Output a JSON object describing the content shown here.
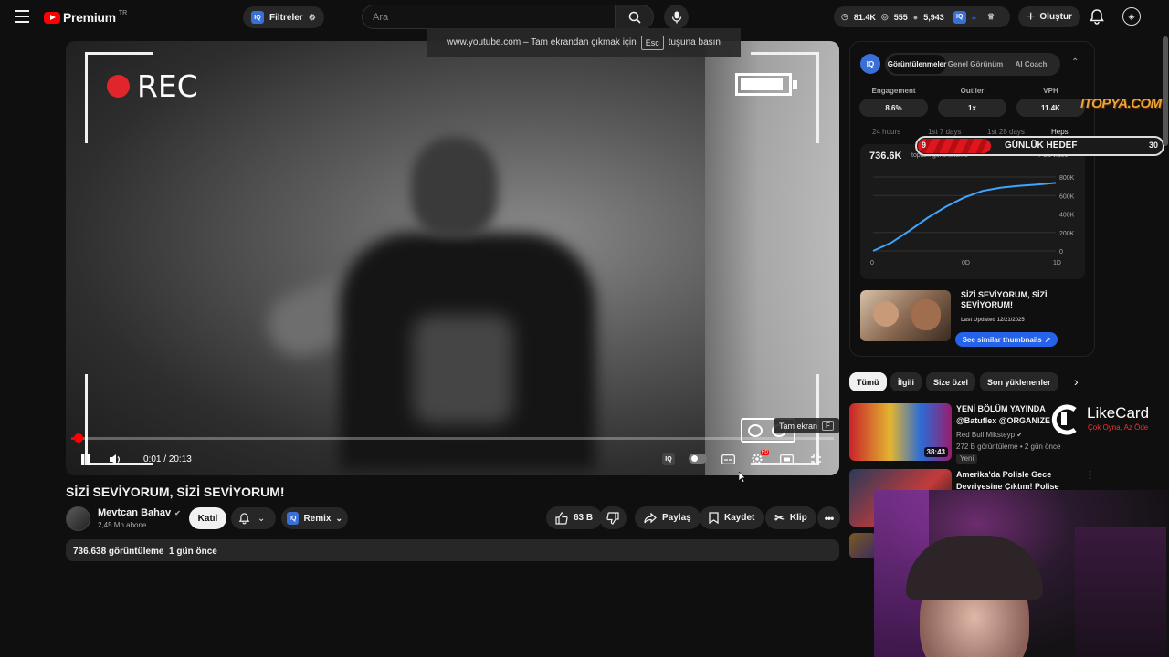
{
  "header": {
    "logo_text": "Premium",
    "logo_sup": "TR",
    "filters_label": "Filtreler",
    "search_placeholder": "Ara",
    "stats": {
      "a": "81.4K",
      "b": "555",
      "c": "5,943"
    },
    "create_label": "Oluştur"
  },
  "fullscreen_notice": {
    "text_before": "www.youtube.com – Tam ekrandan çıkmak için",
    "key": "Esc",
    "text_after": "tuşuna basın"
  },
  "player": {
    "overlay_rec": "REC",
    "time_current": "0:01",
    "time_total": "20:13",
    "progress_fraction": 0.001,
    "tooltip_label": "Tam ekran",
    "tooltip_key": "F"
  },
  "video": {
    "title": "SİZİ SEVİYORUM, SİZİ SEVİYORUM!",
    "channel": "Mevtcan Bahav",
    "subscribers": "2,45 Mn abone",
    "join_label": "Katıl",
    "remix_label": "Remix",
    "likes": "63 B",
    "share_label": "Paylaş",
    "save_label": "Kaydet",
    "clip_label": "Klip",
    "views": "736.638 görüntüleme",
    "ago": "1 gün önce"
  },
  "sidepanel": {
    "tabs": [
      "Görüntülenmeler",
      "Genel Görünüm",
      "AI Coach"
    ],
    "metrics": [
      {
        "label": "Engagement",
        "value": "8.6%"
      },
      {
        "label": "Outlier",
        "value": "1x"
      },
      {
        "label": "VPH",
        "value": "11.4K"
      }
    ],
    "ranges": [
      "24 hours",
      "1st 7 days",
      "1st 28 days",
      "Hepsi"
    ],
    "total_views": "736.6K",
    "chart_subtitle": "toplam görüntüleme",
    "chart_legend": "Bu video",
    "thumb_title": "SİZİ SEVİYORUM, SİZİ SEVİYORUM!",
    "last_updated": "Last Updated 12/21/2025",
    "similar_label": "See similar thumbnails"
  },
  "chart_data": {
    "type": "line",
    "x_ticks": [
      "0",
      "0D",
      "1D"
    ],
    "y_ticks": [
      "0",
      "200K",
      "400K",
      "600K",
      "800K"
    ],
    "ylim": [
      0,
      800000
    ],
    "series": [
      {
        "values": [
          [
            0,
            0
          ],
          [
            0.1,
            90000
          ],
          [
            0.2,
            220000
          ],
          [
            0.3,
            360000
          ],
          [
            0.4,
            480000
          ],
          [
            0.5,
            580000
          ],
          [
            0.6,
            650000
          ],
          [
            0.7,
            685000
          ],
          [
            0.8,
            705000
          ],
          [
            0.9,
            718000
          ],
          [
            1.0,
            736600
          ]
        ]
      }
    ],
    "grid": true
  },
  "goal": {
    "current": "9",
    "label": "GÜNLÜK HEDEF",
    "target": "30",
    "progress_fraction": 0.3
  },
  "chips": [
    "Tümü",
    "İlgili",
    "Size özel",
    "Son yüklenenler"
  ],
  "recommendations": [
    {
      "title": "YENİ BÖLÜM YAYINDA @Batuflex @ORGANIZE",
      "channel": "Red Bull Miksteyp",
      "meta": "272 B görüntüleme • 2 gün önce",
      "badge": "Yeni",
      "duration": "38:43"
    },
    {
      "title": "Amerika'da Polisle Gece Devriyesine Çıktım! Polise Küf...",
      "channel": "",
      "meta": "",
      "badge": "",
      "duration": ""
    }
  ],
  "sponsors": {
    "likecard": "LikeCard",
    "likecard_tag": "Çok Oyna, Az Öde",
    "itopya": "ITOPYA.COM"
  },
  "colors": {
    "accent": "#ff0000",
    "bg": "#0f0f0f",
    "chart_line": "#3ea6ff",
    "link_blue": "#2563eb"
  }
}
